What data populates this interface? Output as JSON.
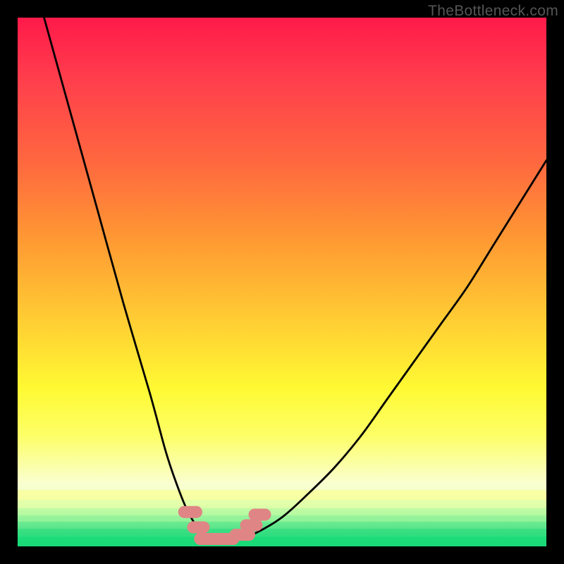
{
  "watermark": "TheBottleneck.com",
  "chart_data": {
    "type": "line",
    "title": "",
    "xlabel": "",
    "ylabel": "",
    "xlim": [
      0,
      100
    ],
    "ylim": [
      0,
      100
    ],
    "series": [
      {
        "name": "bottleneck-curve",
        "x": [
          5,
          10,
          15,
          20,
          25,
          28,
          30,
          32,
          34,
          35,
          36,
          37,
          38,
          39,
          40,
          42,
          45,
          50,
          55,
          60,
          65,
          70,
          75,
          80,
          85,
          90,
          95,
          100
        ],
        "values": [
          100,
          82,
          64,
          46,
          29,
          18,
          12,
          7,
          3.5,
          2.3,
          1.6,
          1.2,
          1.0,
          1.0,
          1.1,
          1.5,
          2.5,
          5.5,
          10,
          15,
          21,
          28,
          35,
          42,
          49,
          57,
          65,
          73
        ]
      }
    ],
    "flat_marker_segments": [
      {
        "x_start": 31.5,
        "x_end": 33.8,
        "y": 6.5
      },
      {
        "x_start": 33.2,
        "x_end": 35.2,
        "y": 3.6
      },
      {
        "x_start": 34.5,
        "x_end": 40.8,
        "y": 1.4
      },
      {
        "x_start": 41.2,
        "x_end": 43.8,
        "y": 2.2
      },
      {
        "x_start": 43.2,
        "x_end": 45.2,
        "y": 4.0
      },
      {
        "x_start": 44.8,
        "x_end": 46.8,
        "y": 6.0
      }
    ],
    "gradient_stops": [
      {
        "pos": 0,
        "color": "#ff1a4a"
      },
      {
        "pos": 42,
        "color": "#ff9933"
      },
      {
        "pos": 70,
        "color": "#fff933"
      },
      {
        "pos": 100,
        "color": "#19d877"
      }
    ]
  }
}
